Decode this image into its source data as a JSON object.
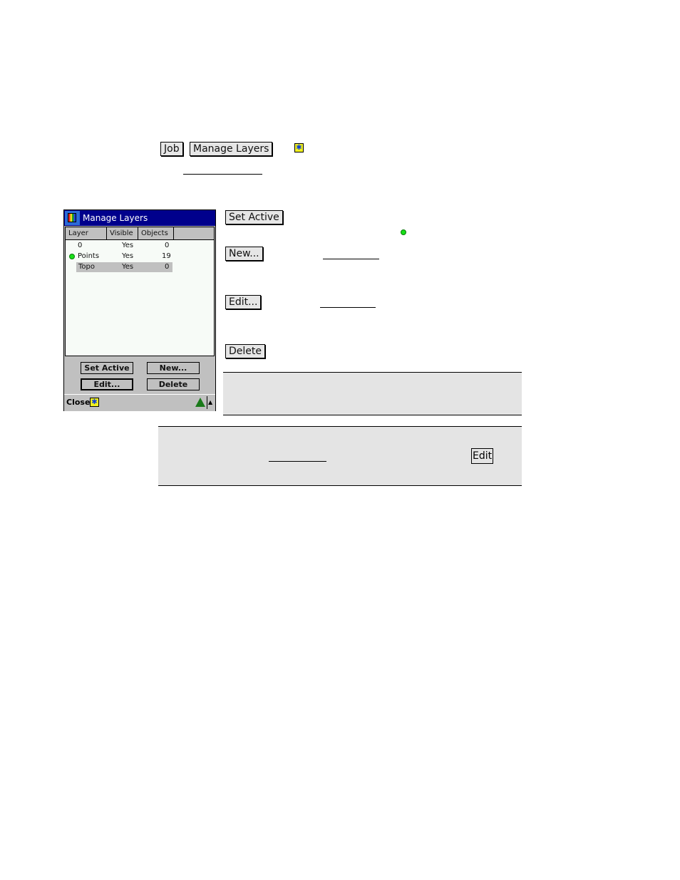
{
  "header_buttons": {
    "job": "Job",
    "manage_layers": "Manage Layers"
  },
  "pda": {
    "title": "Manage Layers",
    "columns": [
      "Layer",
      "Visible",
      "Objects"
    ],
    "rows": [
      {
        "layer": "0",
        "visible": "Yes",
        "objects": "0",
        "active": false,
        "selected": false
      },
      {
        "layer": "Points",
        "visible": "Yes",
        "objects": "19",
        "active": true,
        "selected": false
      },
      {
        "layer": "Topo",
        "visible": "Yes",
        "objects": "0",
        "active": false,
        "selected": true
      }
    ],
    "buttons": {
      "set_active": "Set Active",
      "new": "New...",
      "edit": "Edit...",
      "delete": "Delete"
    },
    "bottom_bar": {
      "close": "Close"
    }
  },
  "descriptions": {
    "set_active_label": "Set Active",
    "new_label": "New...",
    "edit_label": "Edit...",
    "delete_label": "Delete"
  },
  "tip_box": {
    "edit_button_label": "Edit"
  },
  "colors": {
    "title_bar": "#00008c",
    "active_dot": "#18e018",
    "note_bg": "#e4e4e4"
  }
}
